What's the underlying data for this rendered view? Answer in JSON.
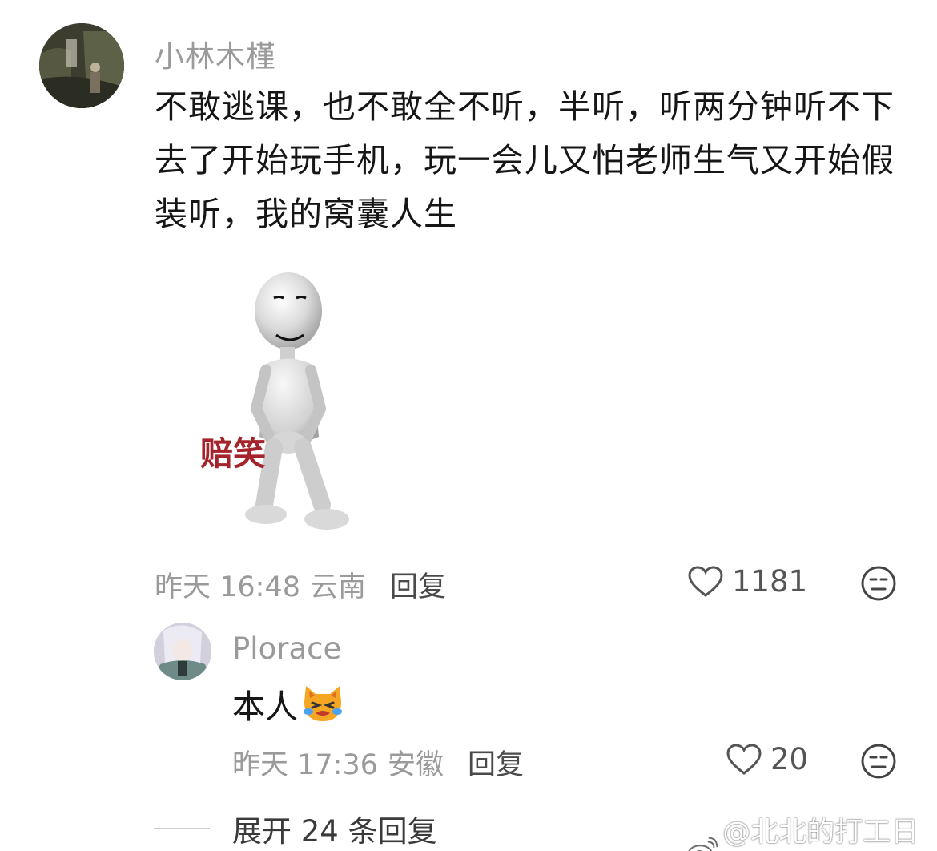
{
  "comment": {
    "author": "小林木槿",
    "text": "不敢逃课，也不敢全不听，半听，听两分钟听不下去了开始玩手机，玩一会儿又怕老师生气又开始假装听，我的窝囊人生",
    "sticker_label": "赔笑",
    "time": "昨天 16:48",
    "location": "云南",
    "reply_label": "回复",
    "likes": "1181"
  },
  "reply": {
    "author": "Plorace",
    "text": "本人",
    "time": "昨天 17:36",
    "location": "安徽",
    "reply_label": "回复",
    "likes": "20"
  },
  "expand_label": "展开 24 条回复",
  "watermark": "@北北的打工日常",
  "icons": {
    "like": "heart-outline-icon",
    "dislike": "neutral-face-icon",
    "reply_emoji": "crying-cat-emoji-icon",
    "watermark": "weibo-logo-icon"
  },
  "colors": {
    "meta_gray": "#9a9a9a",
    "sticker_red": "#a5232a"
  }
}
